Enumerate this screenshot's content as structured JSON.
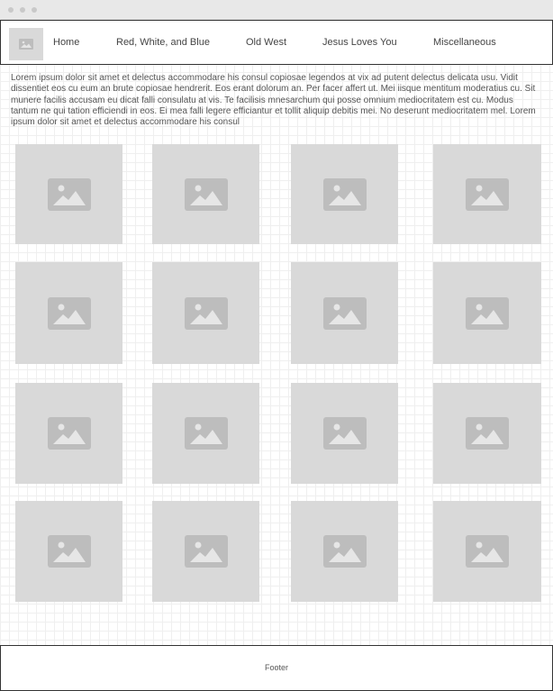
{
  "nav": {
    "links": [
      "Home",
      "Red, White, and Blue",
      "Old West",
      "Jesus Loves You",
      "Miscellaneous"
    ]
  },
  "intro": {
    "text": "Lorem ipsum dolor sit amet et delectus accommodare his consul copiosae legendos at vix ad putent delectus delicata usu. Vidit dissentiet eos cu eum an brute copiosae hendrerit. Eos erant dolorum an. Per facer affert ut. Mei iisque mentitum moderatius cu. Sit munere facilis accusam eu dicat falli consulatu at vis. Te facilisis mnesarchum qui posse omnium mediocritatem est cu. Modus tantum ne qui tation efficiendi in eos. Ei mea falli legere efficiantur et tollit aliquip debitis mei. No deserunt mediocritatem mel. Lorem ipsum dolor sit amet et delectus accommodare his consul"
  },
  "gallery": {
    "icon": "image-placeholder-icon"
  },
  "footer": {
    "label": "Footer"
  },
  "colors": {
    "placeholder": "#d9d9d9",
    "placeholder_icon": "#bdbdbd",
    "border": "#333333"
  }
}
